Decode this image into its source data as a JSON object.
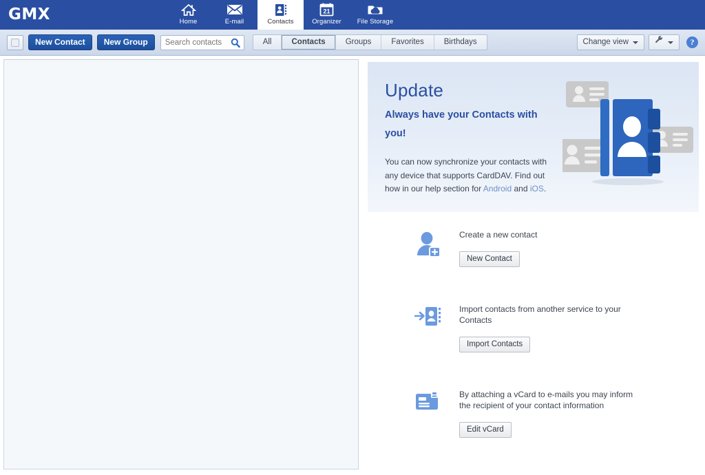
{
  "brand": {
    "logo": "GMX"
  },
  "topnav": {
    "items": [
      {
        "label": "Home",
        "icon": "home-icon",
        "active": false
      },
      {
        "label": "E-mail",
        "icon": "envelope-icon",
        "active": false
      },
      {
        "label": "Contacts",
        "icon": "contacts-book-icon",
        "active": true
      },
      {
        "label": "Organizer",
        "icon": "calendar-21-icon",
        "active": false
      },
      {
        "label": "File Storage",
        "icon": "cloud-folder-icon",
        "active": false
      }
    ]
  },
  "toolbar": {
    "select_all_checkbox": "",
    "new_contact_label": "New Contact",
    "new_group_label": "New Group",
    "search": {
      "placeholder": "Search contacts",
      "value": "",
      "icon": "search-icon"
    },
    "filters": [
      {
        "label": "All",
        "active": false
      },
      {
        "label": "Contacts",
        "active": true
      },
      {
        "label": "Groups",
        "active": false
      },
      {
        "label": "Favorites",
        "active": false
      },
      {
        "label": "Birthdays",
        "active": false
      }
    ],
    "change_view_label": "Change view",
    "settings_icon": "wrench-icon",
    "help_label": "?"
  },
  "banner": {
    "title": "Update",
    "subtitle": "Always have your Contacts with you!",
    "body_part1": "You can now synchronize your contacts with any device that supports CardDAV. Find out how in our help section for ",
    "link_android": "Android",
    "body_and": " and ",
    "link_ios": "iOS",
    "body_end": ".",
    "illustration": "address-book-illustration"
  },
  "actions": [
    {
      "icon": "add-person-icon",
      "title": "Create a new contact",
      "button": "New Contact"
    },
    {
      "icon": "import-contacts-icon",
      "title": "Import contacts from another service to your Contacts",
      "button": "Import Contacts"
    },
    {
      "icon": "vcard-icon",
      "title": "By attaching a vCard to e-mails you may inform the recipient of your contact information",
      "button": "Edit vCard"
    }
  ],
  "colors": {
    "brand_blue": "#2a4fa2",
    "accent_blue": "#1d4e9c",
    "banner_bg": "#dbe5f4",
    "icon_blue": "#6b9ade",
    "link_blue": "#6e8fc4"
  }
}
